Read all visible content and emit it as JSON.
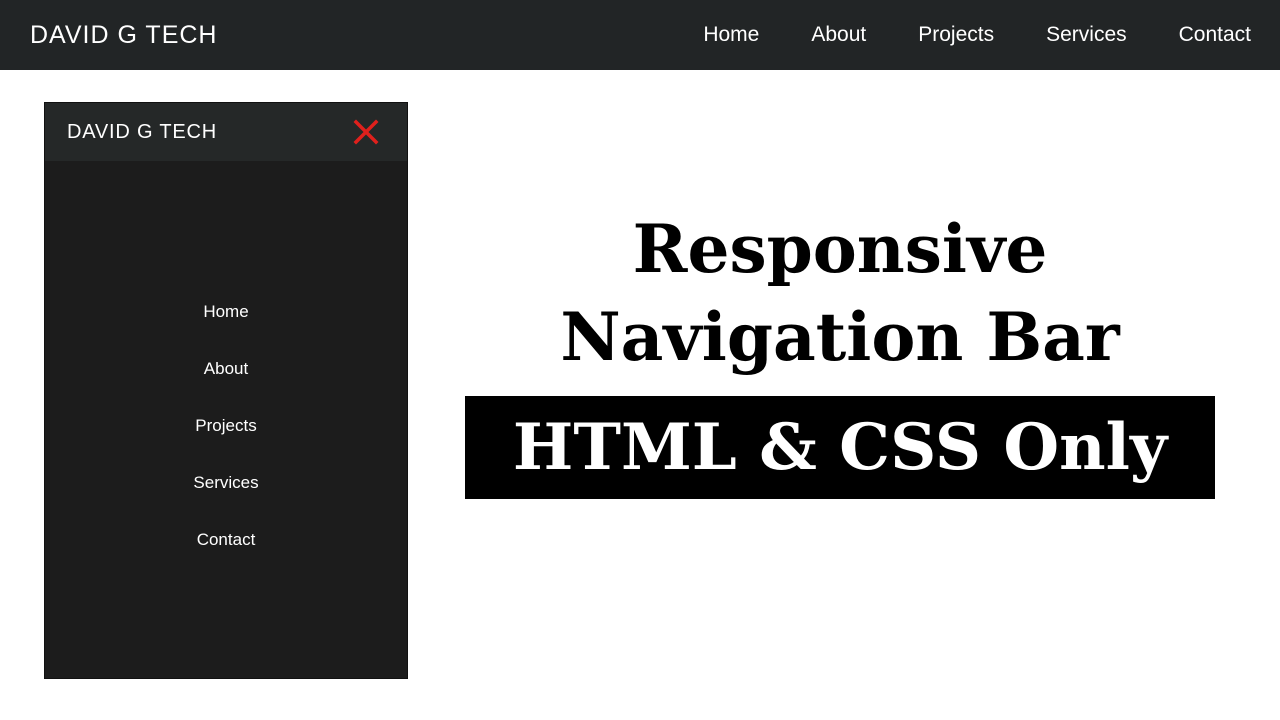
{
  "topbar": {
    "brand": "DAVID G TECH",
    "links": [
      "Home",
      "About",
      "Projects",
      "Services",
      "Contact"
    ]
  },
  "mobile": {
    "brand": "DAVID G TECH",
    "close_icon": "close-icon",
    "close_color": "#e0201c",
    "links": [
      "Home",
      "About",
      "Projects",
      "Services",
      "Contact"
    ]
  },
  "title": {
    "line1": "Responsive",
    "line2": "Navigation Bar",
    "subtitle": "HTML & CSS Only"
  },
  "colors": {
    "navbar_bg": "#222526",
    "mobile_bg": "#1c1c1c",
    "mobile_header_bg": "#252828",
    "subtitle_bg": "#000000"
  }
}
